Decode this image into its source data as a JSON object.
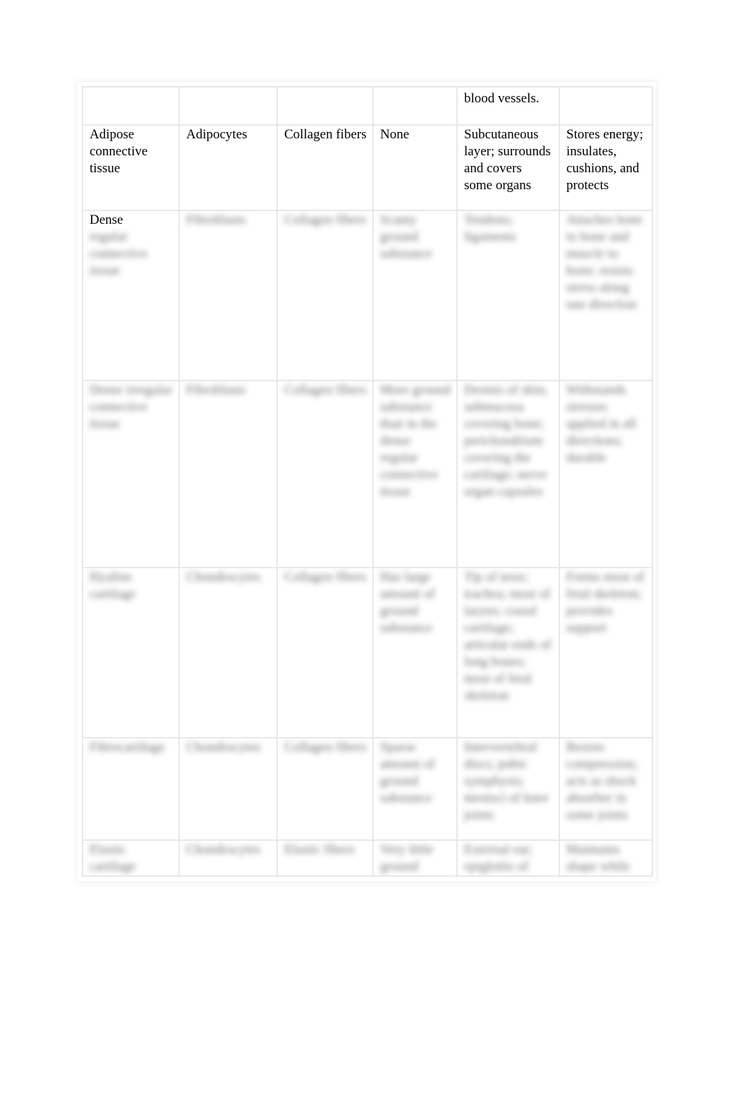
{
  "document": {
    "type": "connective tissue comparison table (continued page)",
    "note": "Only the continuation row, the Adipose connective tissue row, and the word 'Dense' are legible in the screenshot. All cells marked inferred:true are guesses reconstructed from blurred glyph shapes and line counts; they are NOT transcribed from the image and may be wrong."
  },
  "table": {
    "rows": [
      {
        "key": "continuation",
        "inferred": false,
        "cells": [
          "",
          "",
          "",
          "",
          "blood vessels.",
          ""
        ]
      },
      {
        "key": "adipose",
        "inferred": false,
        "cells": [
          "Adipose connective tissue",
          "Adipocytes",
          "Collagen fibers",
          "None",
          "Subcutaneous layer; surrounds and covers some organs",
          "Stores energy; insulates, cushions, and protects"
        ]
      },
      {
        "key": "dense-regular",
        "inferred": true,
        "legible_fragment": "Dense",
        "cells": [
          "Dense regular connective tissue",
          "Fibroblasts",
          "Collagen fibers",
          "Scanty ground substance",
          "Tendons; ligaments",
          "Attaches bone to bone and muscle to bone; resists stress along one direction"
        ]
      },
      {
        "key": "dense-irregular",
        "inferred": true,
        "cells": [
          "Dense irregular connective tissue",
          "Fibroblasts",
          "Collagen fibers",
          "More ground substance than in the dense regular connective tissue",
          "Dermis of skin; submucosa covering bone; perichondrium covering the cartilage; nerve organ capsules",
          "Withstands stresses applied in all directions; durable"
        ]
      },
      {
        "key": "hyaline",
        "inferred": true,
        "cells": [
          "Hyaline cartilage",
          "Chondrocytes",
          "Collagen fibers",
          "Has large amount of ground substance",
          "Tip of nose; trachea; most of larynx; costal cartilage; articular ends of long bones; most of fetal skeleton",
          "Forms most of fetal skeleton; provides support"
        ]
      },
      {
        "key": "fibrocartilage",
        "inferred": true,
        "cells": [
          "Fibrocartilage",
          "Chondrocytes",
          "Collagen fibers",
          "Sparse amount of ground substance",
          "Intervertebral discs; pubic symphysis; menisci of knee joints",
          "Resists compression; acts as shock absorber in some joints"
        ]
      },
      {
        "key": "elastic",
        "inferred": true,
        "cells": [
          "Elastic cartilage",
          "Chondrocytes",
          "Elastic fibers",
          "Very little ground",
          "External ear; epiglottis of",
          "Maintains shape while"
        ]
      }
    ]
  }
}
